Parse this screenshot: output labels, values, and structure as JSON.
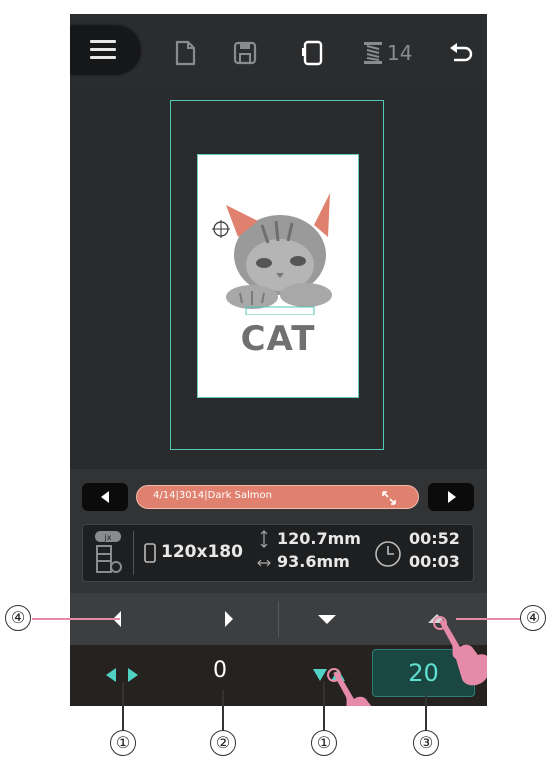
{
  "toolbar": {
    "menu_icon": "hamburger-menu-icon",
    "icons": [
      "new-file-icon",
      "save-icon",
      "hoop-icon",
      "thread-spool-icon",
      "undo-icon"
    ],
    "needle_count": "14"
  },
  "preview": {
    "design_text": "CAT"
  },
  "color_bar": {
    "prev_icon": "triangle-left-icon",
    "next_icon": "triangle-right-icon",
    "color_label": "4/14|3014|Dark Salmon",
    "color": "#e0806e",
    "expand_icon": "expand-arrows-icon"
  },
  "info": {
    "hoop_size": "120x180",
    "height": "120.7mm",
    "width": "93.6mm",
    "time_total": "00:52",
    "time_remaining": "00:03"
  },
  "move_row": {
    "left_icon": "arrow-left-icon",
    "right_icon": "arrow-right-icon",
    "down_icon": "arrow-down-icon",
    "up_icon": "arrow-up-icon"
  },
  "bottom_row": {
    "h_arrows_icon": "left-right-arrows-icon",
    "position_value": "0",
    "v_arrows_icon": "down-up-arrows-icon",
    "step_value": "20"
  },
  "callouts": {
    "c1_left": "①",
    "c2": "②",
    "c1_right": "①",
    "c3": "③",
    "c4_left": "④",
    "c4_right": "④"
  },
  "colors": {
    "accent": "#5fe0cf",
    "hoop_line": "#52c8b8",
    "pointer_hand": "#e58aa9"
  }
}
